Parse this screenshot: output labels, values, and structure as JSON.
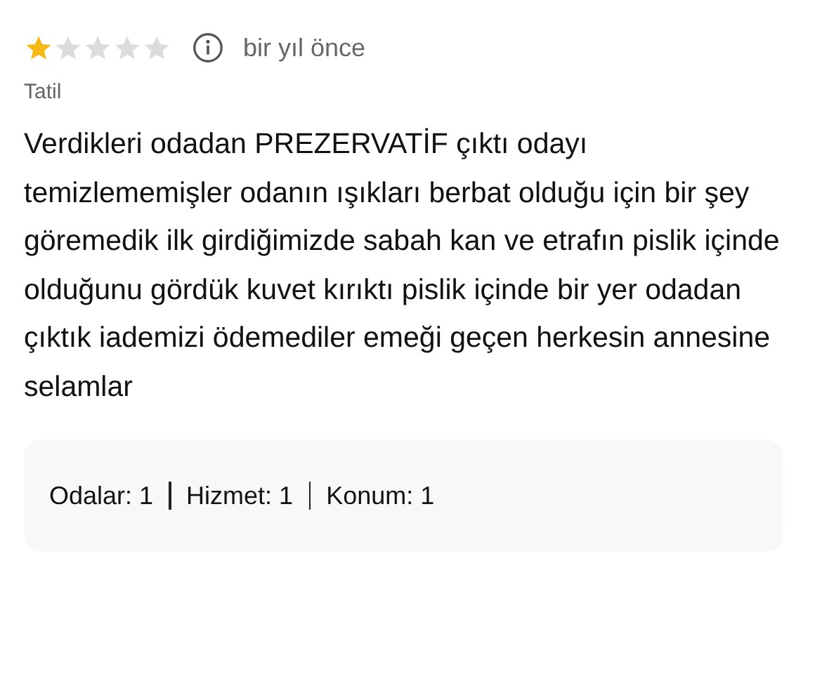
{
  "review": {
    "stars": 1,
    "time": "bir yıl önce",
    "category": "Tatil",
    "text": "Verdikleri odadan PREZERVATİF çıktı odayı temizlememişler odanın ışıkları berbat olduğu için bir şey göremedik ilk girdiğimizde sabah kan ve etrafın pislik içinde olduğunu gördük kuvet kırıktı pislik içinde bir yer odadan çıktık iademizi ödemediler emeği geçen herkesin annesine selamlar"
  },
  "ratings": [
    {
      "label": "Odalar: 1"
    },
    {
      "label": "Hizmet: 1"
    },
    {
      "label": "Konum: 1"
    }
  ]
}
